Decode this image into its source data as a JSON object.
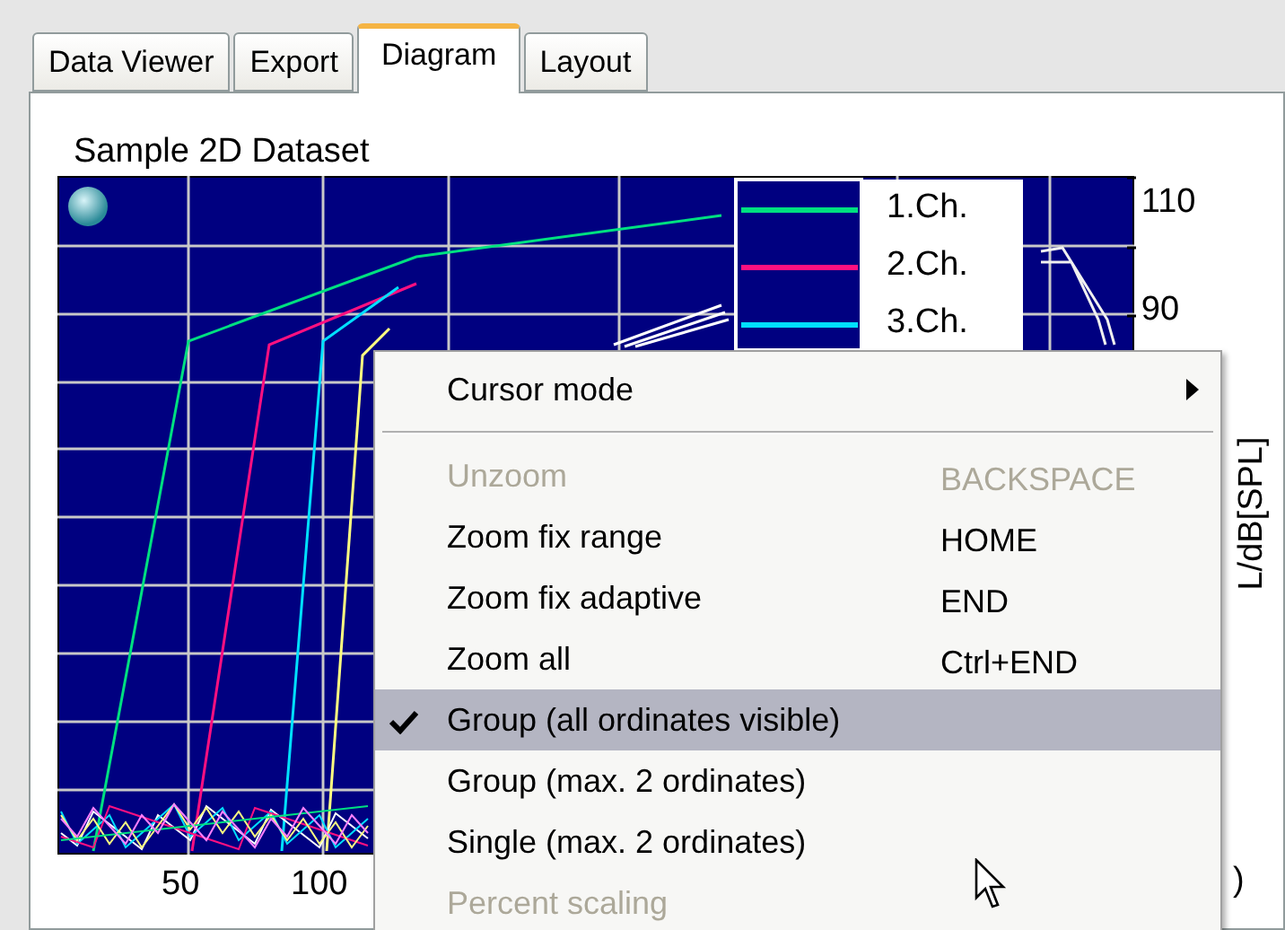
{
  "tabs": [
    {
      "label": "Data Viewer",
      "selected": false
    },
    {
      "label": "Export",
      "selected": false
    },
    {
      "label": "Diagram",
      "selected": true
    },
    {
      "label": "Layout",
      "selected": false
    }
  ],
  "dataset_title": "Sample 2D Dataset",
  "plot": {
    "legend": [
      {
        "label": "1.Ch.",
        "color": "#00e080"
      },
      {
        "label": "2.Ch.",
        "color": "#ff1080"
      },
      {
        "label": "3.Ch.",
        "color": "#00e0ff"
      }
    ],
    "y_tick_labels": [
      "110",
      "90"
    ],
    "y_axis_label": "L/dB[SPL]",
    "x_tick_labels": [
      "50",
      "100"
    ],
    "x_axis_label_fragment": ")"
  },
  "context_menu": {
    "items": [
      {
        "kind": "submenu",
        "label": "Cursor mode",
        "disabled": false,
        "checked": false,
        "selected": false
      },
      {
        "kind": "separator"
      },
      {
        "kind": "item",
        "label": "Unzoom",
        "shortcut": "BACKSPACE",
        "disabled": true,
        "checked": false,
        "selected": false
      },
      {
        "kind": "item",
        "label": "Zoom fix range",
        "shortcut": "HOME",
        "disabled": false,
        "checked": false,
        "selected": false
      },
      {
        "kind": "item",
        "label": "Zoom fix adaptive",
        "shortcut": "END",
        "disabled": false,
        "checked": false,
        "selected": false
      },
      {
        "kind": "item",
        "label": "Zoom all",
        "shortcut": "Ctrl+END",
        "disabled": false,
        "checked": false,
        "selected": false
      },
      {
        "kind": "item",
        "label": "Group (all ordinates visible)",
        "disabled": false,
        "checked": true,
        "selected": true
      },
      {
        "kind": "item",
        "label": "Group (max. 2 ordinates)",
        "disabled": false,
        "checked": false,
        "selected": false
      },
      {
        "kind": "item",
        "label": "Single (max. 2 ordinates)",
        "disabled": false,
        "checked": false,
        "selected": false
      },
      {
        "kind": "item",
        "label": "Percent scaling",
        "disabled": true,
        "checked": false,
        "selected": false
      }
    ]
  }
}
